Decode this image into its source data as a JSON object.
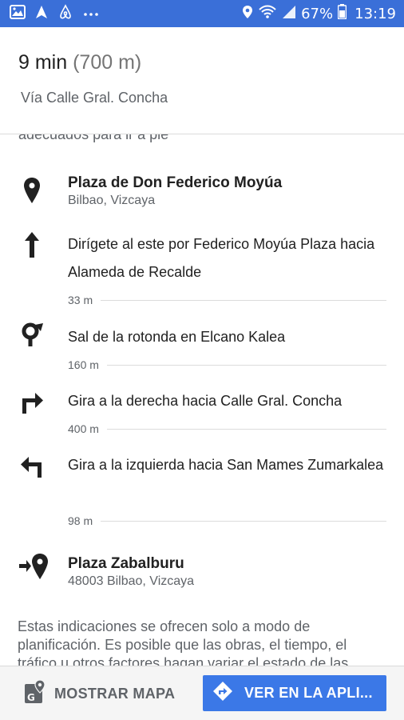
{
  "status_bar": {
    "battery": "67%",
    "time": "13:19",
    "icons": [
      "gallery-icon",
      "navigation-icon",
      "airbnb-icon",
      "more-dots-icon",
      "location-icon",
      "wifi-icon",
      "signal-icon",
      "battery-icon"
    ]
  },
  "header": {
    "duration": "9 min",
    "distance": "(700 m)",
    "via": "Vía Calle Gral. Concha"
  },
  "cut_text": "adecuados para ir a pie",
  "origin": {
    "title": "Plaza de Don Federico Moyúa",
    "subtitle": "Bilbao, Vizcaya",
    "icon": "location-pin-icon"
  },
  "steps": [
    {
      "icon": "arrow-straight-icon",
      "text": "Dirígete al este por Federico Moyúa Plaza hacia Alameda de Recalde",
      "distance": "33 m"
    },
    {
      "icon": "roundabout-exit-icon",
      "text": "Sal de la rotonda en Elcano Kalea",
      "distance": "160 m"
    },
    {
      "icon": "turn-right-icon",
      "text": "Gira a la derecha hacia Calle Gral. Concha",
      "distance": "400 m"
    },
    {
      "icon": "turn-left-icon",
      "text": "Gira a la izquierda hacia San Mames Zumarkalea",
      "distance": "98 m"
    }
  ],
  "destination": {
    "title": "Plaza Zabalburu",
    "subtitle": "48003 Bilbao, Vizcaya",
    "icon": "arrive-destination-icon"
  },
  "disclaimer": "Estas indicaciones se ofrecen solo a modo de planificación. Es posible que las obras, el tiempo, el tráfico u otros factores hagan variar el estado de las",
  "bottom_bar": {
    "map_label": "MOSTRAR MAPA",
    "app_label": "VER EN LA APLI...",
    "accent": "#3b78e7"
  }
}
